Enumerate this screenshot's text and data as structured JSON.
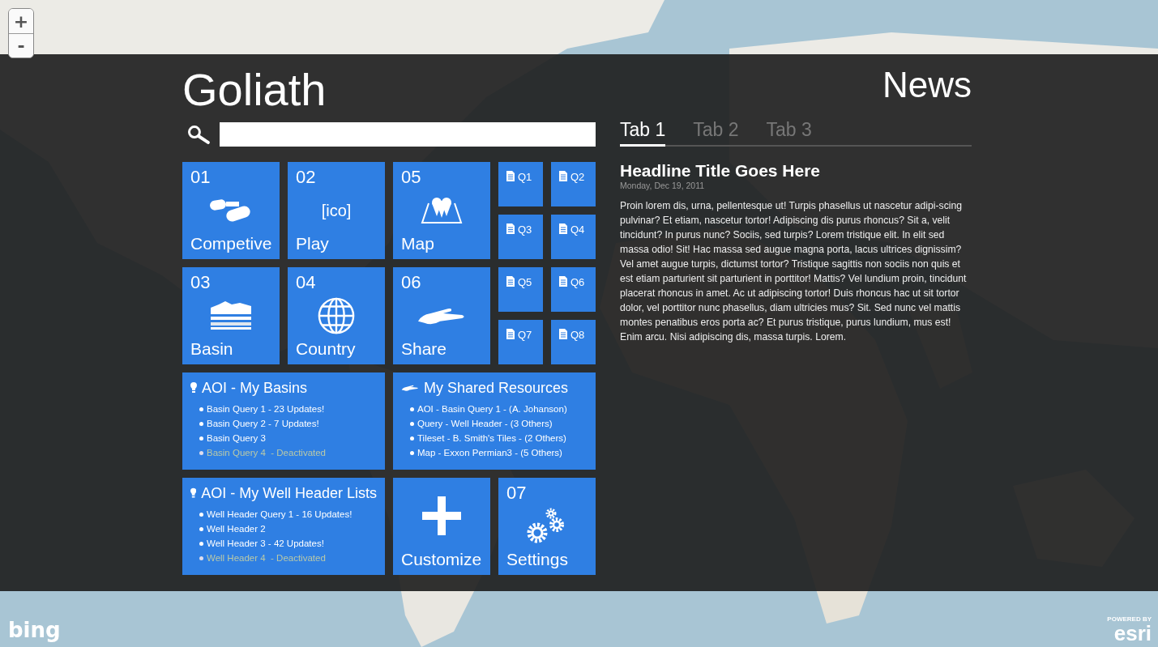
{
  "zoom_controls": [
    "+",
    "-"
  ],
  "app_title": "Goliath",
  "tiles": [
    {
      "kind": "binoculars",
      "number": "01",
      "label": "Competive"
    },
    {
      "kind": "placeholder",
      "number": "02",
      "label": "Play",
      "icon_text": "[ico]"
    },
    {
      "kind": "map",
      "number": "05",
      "label": "Map"
    },
    {
      "kind": "queries",
      "items": [
        "Q1",
        "Q2",
        "Q3",
        "Q4"
      ]
    },
    {
      "kind": "basin",
      "number": "03",
      "label": "Basin"
    },
    {
      "kind": "globe",
      "number": "04",
      "label": "Country"
    },
    {
      "kind": "share",
      "number": "06",
      "label": "Share"
    },
    {
      "kind": "queries",
      "items": [
        "Q5",
        "Q6",
        "Q7",
        "Q8"
      ]
    },
    {
      "kind": "aoi",
      "title": "AOI - My Basins",
      "items": [
        {
          "text": "Basin Query 1 - 23 Updates!",
          "disabled": false
        },
        {
          "text": "Basin Query 2 - 7 Updates!",
          "disabled": false
        },
        {
          "text": "Basin Query 3",
          "disabled": false
        },
        {
          "text": "Basin Query 4  - Deactivated",
          "disabled": true
        }
      ]
    },
    {
      "kind": "shared",
      "title": "My Shared Resources",
      "items": [
        {
          "text": "AOI - Basin Query 1 - (A. Johanson)",
          "disabled": false
        },
        {
          "text": "Query - Well Header - (3 Others)",
          "disabled": false
        },
        {
          "text": "Tileset - B. Smith's Tiles - (2 Others)",
          "disabled": false
        },
        {
          "text": "Map - Exxon Permian3 - (5 Others)",
          "disabled": false
        }
      ]
    },
    {
      "kind": "aoi",
      "title": "AOI - My Well Header Lists",
      "items": [
        {
          "text": "Well Header Query 1 - 16 Updates!",
          "disabled": false
        },
        {
          "text": "Well Header 2",
          "disabled": false
        },
        {
          "text": "Well Header 3 - 42 Updates!",
          "disabled": false
        },
        {
          "text": "Well Header 4  - Deactivated",
          "disabled": true
        }
      ]
    },
    {
      "kind": "customize",
      "label": "Customize"
    },
    {
      "kind": "settings",
      "number": "07",
      "label": "Settings"
    }
  ],
  "news": {
    "title": "News",
    "tabs": [
      {
        "label": "Tab 1",
        "selected": true
      },
      {
        "label": "Tab 2",
        "selected": false
      },
      {
        "label": "Tab 3",
        "selected": false
      }
    ],
    "headline": "Headline Title Goes Here",
    "date": "Monday, Dec 19, 2011",
    "body": "Proin lorem dis, urna, pellentesque ut! Turpis phasellus ut nascetur adipi-scing pulvinar? Et etiam, nascetur tortor! Adipiscing dis purus rhoncus? Sit a, velit tincidunt? In purus nunc? Sociis, sed turpis? Lorem tristique elit. In elit sed massa odio! Sit! Hac massa sed augue magna porta, lacus ultrices dignissim? Vel amet augue turpis, dictumst tortor? Tristique sagittis non sociis non quis et est etiam parturient sit parturient in porttitor! Mattis? Vel lundium proin, tincidunt placerat rhoncus in amet. Ac ut adipiscing tortor! Duis rhoncus hac ut sit tortor dolor, vel porttitor nunc phasellus, diam ultricies mus? Sit. Sed nunc vel mattis montes penatibus eros porta ac? Et purus tristique, purus lundium, mus est! Enim arcu. Nisi adipiscing dis, massa turpis. Lorem."
  },
  "attribution": {
    "left_logo": "bing",
    "right_caption": "POWERED BY",
    "right_logo": "esri"
  }
}
